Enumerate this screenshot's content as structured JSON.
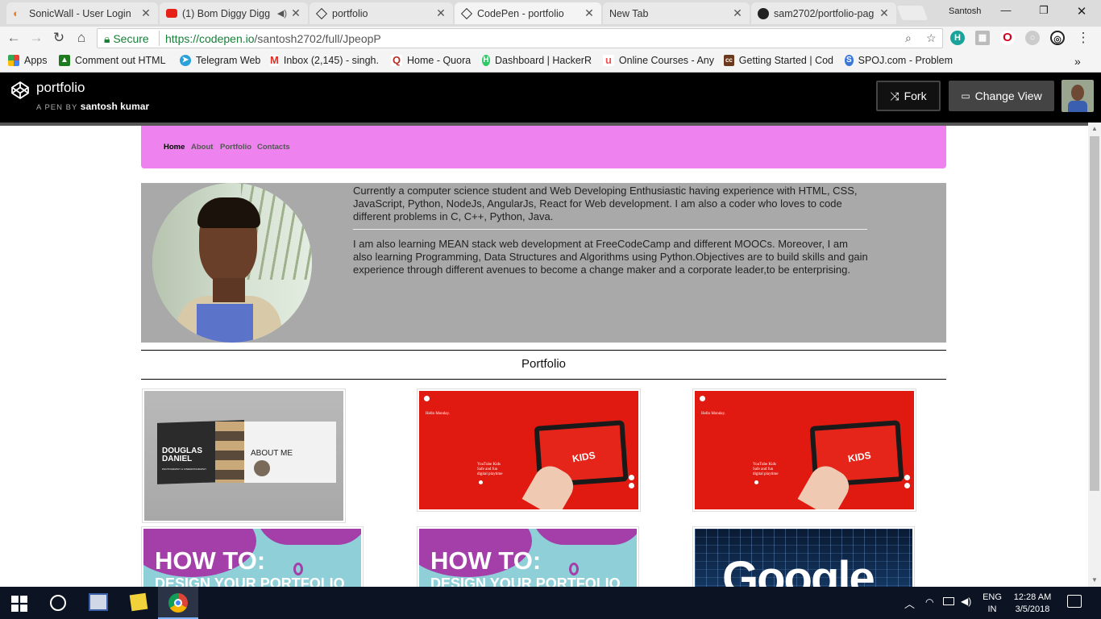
{
  "browser": {
    "tabs": [
      {
        "title": "SonicWall - User Login",
        "icon": "sonicwall-icon"
      },
      {
        "title": "(1) Bom Diggy Digg",
        "icon": "youtube-icon"
      },
      {
        "title": "portfolio",
        "icon": "codepen-icon"
      },
      {
        "title": "CodePen - portfolio",
        "icon": "codepen-icon",
        "active": true
      },
      {
        "title": "New Tab",
        "icon": ""
      },
      {
        "title": "sam2702/portfolio-pag",
        "icon": "github-icon"
      }
    ],
    "profile_name": "Santosh",
    "secure_label": "Secure",
    "url_host": "https://codepen.io",
    "url_path": "/santosh2702/full/JpeopP",
    "bookmarks": [
      {
        "label": "Apps",
        "icon": "apps-grid-icon",
        "color": "#e94235"
      },
      {
        "label": "Comment out HTML",
        "icon": "bookmark-green-icon",
        "color": "#1e7a1e"
      },
      {
        "label": "Telegram Web",
        "icon": "telegram-icon",
        "color": "#2aa1da"
      },
      {
        "label": "Inbox (2,145) - singh.",
        "icon": "gmail-icon",
        "color": "#d93025"
      },
      {
        "label": "Home - Quora",
        "icon": "quora-icon",
        "color": "#b92b27"
      },
      {
        "label": "Dashboard | HackerR",
        "icon": "hackerrank-icon",
        "color": "#2ec866"
      },
      {
        "label": "Online Courses - Any",
        "icon": "udemy-icon",
        "color": "#ec5252"
      },
      {
        "label": "Getting Started | Cod",
        "icon": "codecademy-icon",
        "color": "#6b3a1e"
      },
      {
        "label": "SPOJ.com - Problem",
        "icon": "spoj-icon",
        "color": "#3b77d8"
      }
    ],
    "bookmarks_more": "»"
  },
  "codepen": {
    "title": "portfolio",
    "by_label": "A PEN BY",
    "author": "santosh kumar",
    "fork_label": "Fork",
    "change_view_label": "Change View"
  },
  "page": {
    "nav": [
      "Home",
      "About",
      "Portfolio",
      "Contacts"
    ],
    "about_p1": "Currently a computer science student and Web Developing Enthusiastic having experience with HTML, CSS, JavaScript, Python, NodeJs, AngularJs, React for Web development. I am also a coder who loves to code different problems in C, C++, Python, Java.",
    "about_p2": "I am also learning MEAN stack web development at FreeCodeCamp and different MOOCs. Moreover, I am also learning Programming, Data Structures and Algorithms using Python.Objectives are to build skills and gain experience through different avenues to become a change maker and a corporate leader,to be enterprising.",
    "portfolio_heading": "Portfolio",
    "thumbs": [
      {
        "kind": "book",
        "title1": "DOUGLAS",
        "title2": "DANIEL",
        "sub": "PHOTOGRAPHY & CINEMATOGRAPHY",
        "right": "ABOUT ME"
      },
      {
        "kind": "youtube",
        "hello": "Hello Monday.",
        "line1": "YouTube Kids",
        "line2": "Safe and fun",
        "line3": "digital playtime"
      },
      {
        "kind": "youtube",
        "hello": "Hello Monday.",
        "line1": "YouTube Kids",
        "line2": "Safe and fun",
        "line3": "digital playtime"
      },
      {
        "kind": "howto",
        "line1": "HOW TO:",
        "line2": "DESIGN YOUR PORTFOLIO"
      },
      {
        "kind": "howto",
        "line1": "HOW TO:",
        "line2": "DESIGN YOUR PORTFOLIO"
      },
      {
        "kind": "google",
        "line1": "Google"
      }
    ]
  },
  "taskbar": {
    "lang1": "ENG",
    "lang2": "IN",
    "time": "12:28 AM",
    "date": "3/5/2018"
  }
}
